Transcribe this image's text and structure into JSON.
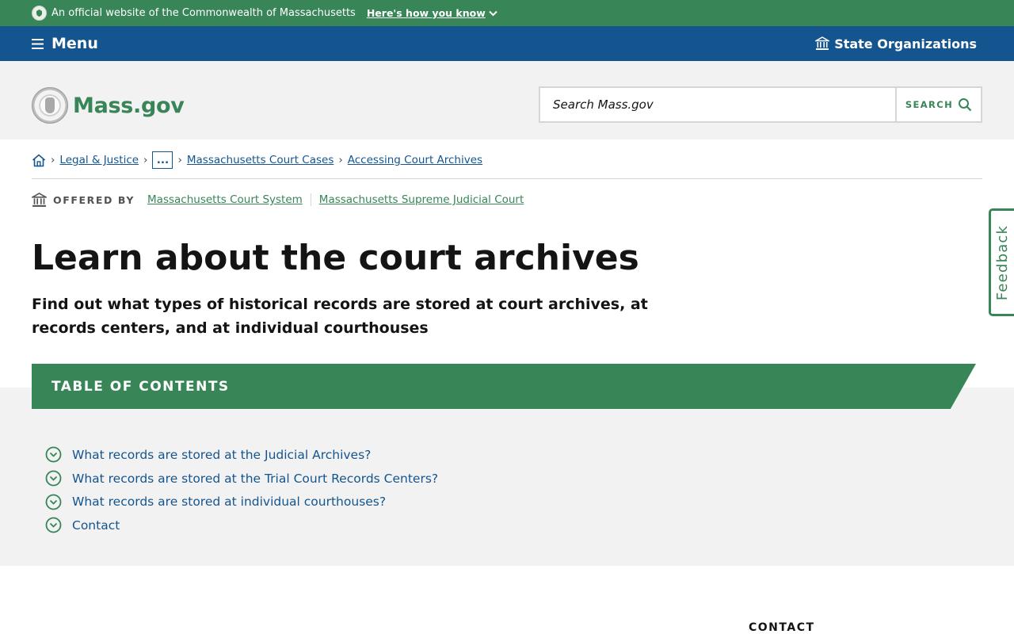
{
  "official_banner": {
    "text": "An official website of the Commonwealth of Massachusetts",
    "how_you_know": "Here's how you know"
  },
  "nav": {
    "menu_label": "Menu",
    "state_orgs_label": "State Organizations"
  },
  "header": {
    "brand": "Mass.gov",
    "search_placeholder": "Search Mass.gov",
    "search_button": "SEARCH"
  },
  "breadcrumb": {
    "items": [
      "Legal & Justice",
      "...",
      "Massachusetts Court Cases",
      "Accessing Court Archives"
    ]
  },
  "offered_by": {
    "label": "OFFERED BY",
    "orgs": [
      "Massachusetts Court System",
      "Massachusetts Supreme Judicial Court"
    ]
  },
  "page": {
    "title": "Learn about the court archives",
    "lede": "Find out what types of historical records are stored at court archives, at records centers, and at individual courthouses"
  },
  "toc": {
    "heading": "TABLE OF CONTENTS",
    "items": [
      "What records are stored at the Judicial Archives?",
      "What records are stored at the Trial Court Records Centers?",
      "What records are stored at individual courthouses?",
      "Contact"
    ]
  },
  "sidebar": {
    "contact_heading": "CONTACT"
  },
  "feedback_label": "Feedback",
  "colors": {
    "green": "#388557",
    "blue": "#14558f",
    "gray_bg": "#f2f2f2"
  }
}
